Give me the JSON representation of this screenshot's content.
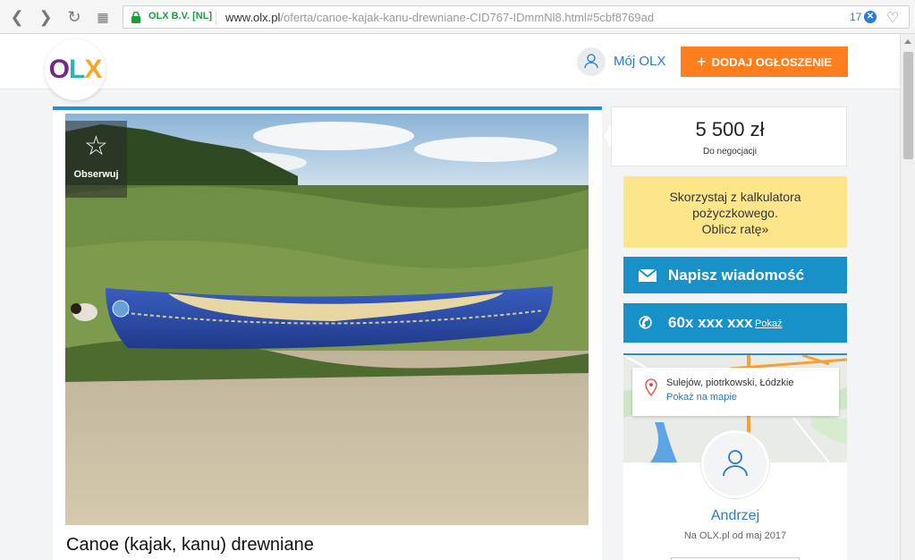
{
  "browser": {
    "cert_label": "OLX B.V. [NL]",
    "url_domain": "www.olx.pl",
    "url_path": "/oferta/canoe-kajak-kanu-drewniane-CID767-IDmmNl8.html#5cbf8769ad",
    "badge_count": "17",
    "badge_x": "✕",
    "icons": [
      "back-icon",
      "forward-icon",
      "reload-icon",
      "grid-icon",
      "lock-icon",
      "heart-icon"
    ]
  },
  "header": {
    "logo_text": {
      "o": "O",
      "l": "L",
      "x": "X"
    },
    "my_account": "Mój OLX",
    "add_button_plus": "+",
    "add_button": "DODAJ OGŁOSZENIE",
    "colors": {
      "brand_orange": "#ff7e1d",
      "brand_blue": "#1890c8"
    }
  },
  "listing": {
    "follow_label": "Obserwuj",
    "title": "Canoe (kajak, kanu) drewniane"
  },
  "sidebar": {
    "price": "5 500 zł",
    "negotiable": "Do negocjacji",
    "calculator": {
      "line1": "Skorzystaj z kalkulatora",
      "line2": "pożyczkowego.",
      "line3": "Oblicz ratę»"
    },
    "message_button": "Napisz wiadomość",
    "phone_masked": "60x xxx xxx",
    "phone_show": "Pokaż",
    "location": "Sulejów, piotrkowski, Łódzkie",
    "show_on_map": "Pokaż na mapie",
    "seller_name": "Andrzej",
    "seller_since": "Na OLX.pl od maj 2017"
  }
}
